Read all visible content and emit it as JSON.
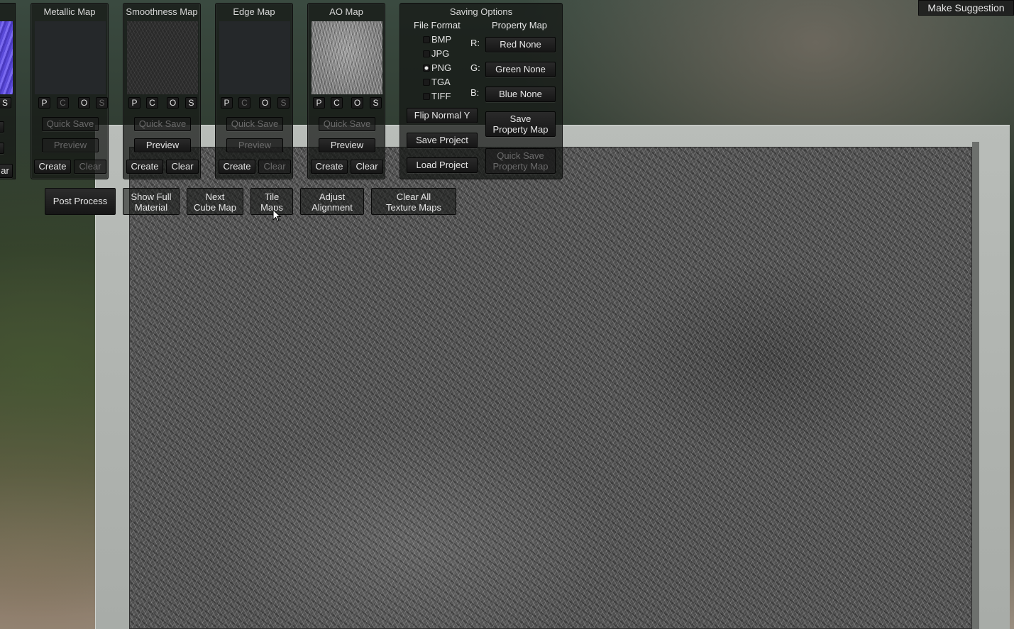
{
  "top_right": {
    "make_suggestion": "Make Suggestion"
  },
  "left_strip": {
    "s_label": "S",
    "clear_label": "ar"
  },
  "panels": [
    {
      "title": "Metallic Map",
      "p": "P",
      "c": "C",
      "o": "O",
      "s": "S",
      "quick_save": "Quick Save",
      "preview": "Preview",
      "create": "Create",
      "clear": "Clear"
    },
    {
      "title": "Smoothness Map",
      "p": "P",
      "c": "C",
      "o": "O",
      "s": "S",
      "quick_save": "Quick Save",
      "preview": "Preview",
      "create": "Create",
      "clear": "Clear"
    },
    {
      "title": "Edge Map",
      "p": "P",
      "c": "C",
      "o": "O",
      "s": "S",
      "quick_save": "Quick Save",
      "preview": "Preview",
      "create": "Create",
      "clear": "Clear"
    },
    {
      "title": "AO Map",
      "p": "P",
      "c": "C",
      "o": "O",
      "s": "S",
      "quick_save": "Quick Save",
      "preview": "Preview",
      "create": "Create",
      "clear": "Clear"
    }
  ],
  "saving": {
    "title": "Saving Options",
    "file_format_label": "File Format",
    "property_map_label": "Property Map",
    "formats": [
      "BMP",
      "JPG",
      "PNG",
      "TGA",
      "TIFF"
    ],
    "selected_format": "PNG",
    "r_label": "R:",
    "g_label": "G:",
    "b_label": "B:",
    "red_btn": "Red None",
    "green_btn": "Green None",
    "blue_btn": "Blue None",
    "flip_normal": "Flip Normal Y",
    "save_property_line1": "Save",
    "save_property_line2": "Property Map",
    "save_project": "Save Project",
    "load_project": "Load Project",
    "quick_save_prop_line1": "Quick Save",
    "quick_save_prop_line2": "Property Map"
  },
  "toolbar": {
    "post_process": "Post Process",
    "show_full_1": "Show Full",
    "show_full_2": "Material",
    "next_cube_1": "Next",
    "next_cube_2": "Cube Map",
    "tile_1": "Tile",
    "tile_2": "Maps",
    "adjust_1": "Adjust",
    "adjust_2": "Alignment",
    "clear_all_1": "Clear All",
    "clear_all_2": "Texture Maps"
  }
}
